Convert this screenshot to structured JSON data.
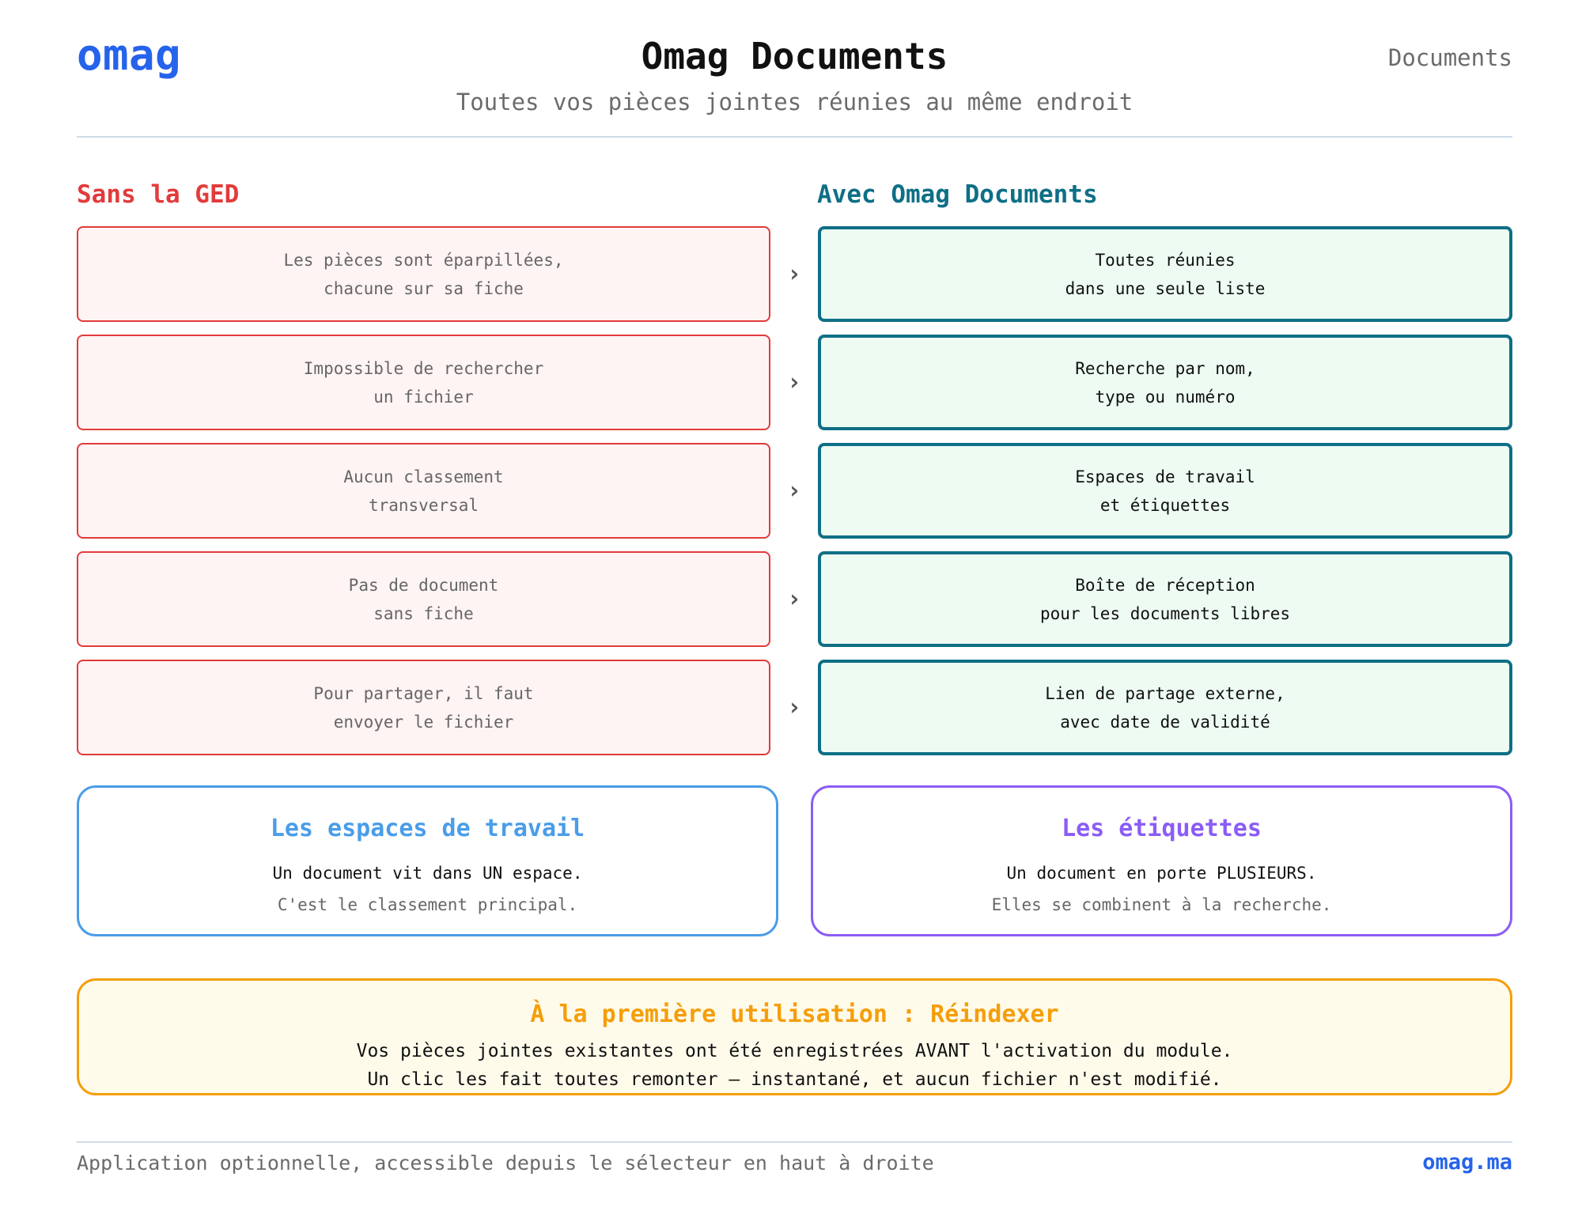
{
  "header": {
    "logo": "omag",
    "title": "Omag Documents",
    "nav_label": "Documents",
    "subtitle": "Toutes vos pièces jointes réunies au même endroit"
  },
  "comparison": {
    "without_heading": "Sans la GED",
    "with_heading": "Avec Omag Documents",
    "arrow_glyph": "›",
    "rows": [
      {
        "without": [
          "Les pièces sont éparpillées,",
          "chacune sur sa fiche"
        ],
        "with": [
          "Toutes réunies",
          "dans une seule liste"
        ]
      },
      {
        "without": [
          "Impossible de rechercher",
          "un fichier"
        ],
        "with": [
          "Recherche par nom,",
          "type ou numéro"
        ]
      },
      {
        "without": [
          "Aucun classement",
          "transversal"
        ],
        "with": [
          "Espaces de travail",
          "et étiquettes"
        ]
      },
      {
        "without": [
          "Pas de document",
          "sans fiche"
        ],
        "with": [
          "Boîte de réception",
          "pour les documents libres"
        ]
      },
      {
        "without": [
          "Pour partager, il faut",
          "envoyer le fichier"
        ],
        "with": [
          "Lien de partage externe,",
          "avec date de validité"
        ]
      }
    ]
  },
  "cards": {
    "spaces": {
      "title": "Les espaces de travail",
      "line1": "Un document vit dans UN espace.",
      "line2": "C'est le classement principal."
    },
    "tags": {
      "title": "Les étiquettes",
      "line1": "Un document en porte PLUSIEURS.",
      "line2": "Elles se combinent à la recherche."
    }
  },
  "reindex": {
    "title": "À la première utilisation : Réindexer",
    "line1": "Vos pièces jointes existantes ont été enregistrées AVANT l'activation du module.",
    "line2": "Un clic les fait toutes remonter — instantané, et aucun fichier n'est modifié."
  },
  "footer": {
    "note": "Application optionnelle, accessible depuis le sélecteur en haut à droite",
    "link": "omag.ma"
  },
  "colors": {
    "brand_blue": "#2563eb",
    "without_red": "#e23b3b",
    "with_teal": "#0e6f86",
    "spaces_blue": "#4a9de8",
    "tags_purple": "#8b5cf6",
    "reindex_amber": "#f59e0b"
  }
}
